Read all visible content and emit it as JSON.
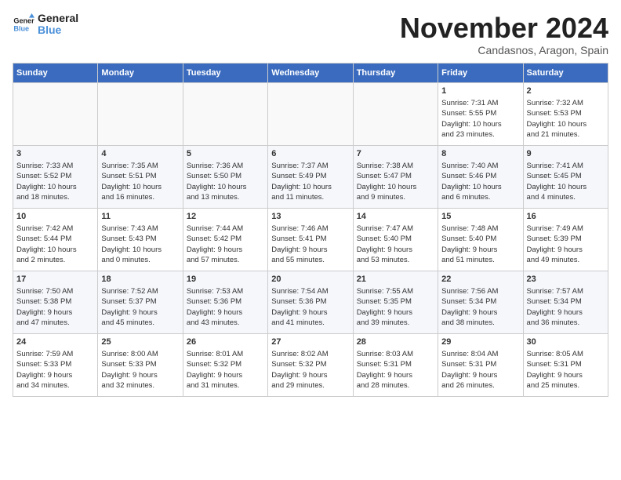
{
  "logo": {
    "line1": "General",
    "line2": "Blue"
  },
  "title": "November 2024",
  "subtitle": "Candasnos, Aragon, Spain",
  "days_of_week": [
    "Sunday",
    "Monday",
    "Tuesday",
    "Wednesday",
    "Thursday",
    "Friday",
    "Saturday"
  ],
  "weeks": [
    [
      {
        "day": "",
        "info": ""
      },
      {
        "day": "",
        "info": ""
      },
      {
        "day": "",
        "info": ""
      },
      {
        "day": "",
        "info": ""
      },
      {
        "day": "",
        "info": ""
      },
      {
        "day": "1",
        "info": "Sunrise: 7:31 AM\nSunset: 5:55 PM\nDaylight: 10 hours\nand 23 minutes."
      },
      {
        "day": "2",
        "info": "Sunrise: 7:32 AM\nSunset: 5:53 PM\nDaylight: 10 hours\nand 21 minutes."
      }
    ],
    [
      {
        "day": "3",
        "info": "Sunrise: 7:33 AM\nSunset: 5:52 PM\nDaylight: 10 hours\nand 18 minutes."
      },
      {
        "day": "4",
        "info": "Sunrise: 7:35 AM\nSunset: 5:51 PM\nDaylight: 10 hours\nand 16 minutes."
      },
      {
        "day": "5",
        "info": "Sunrise: 7:36 AM\nSunset: 5:50 PM\nDaylight: 10 hours\nand 13 minutes."
      },
      {
        "day": "6",
        "info": "Sunrise: 7:37 AM\nSunset: 5:49 PM\nDaylight: 10 hours\nand 11 minutes."
      },
      {
        "day": "7",
        "info": "Sunrise: 7:38 AM\nSunset: 5:47 PM\nDaylight: 10 hours\nand 9 minutes."
      },
      {
        "day": "8",
        "info": "Sunrise: 7:40 AM\nSunset: 5:46 PM\nDaylight: 10 hours\nand 6 minutes."
      },
      {
        "day": "9",
        "info": "Sunrise: 7:41 AM\nSunset: 5:45 PM\nDaylight: 10 hours\nand 4 minutes."
      }
    ],
    [
      {
        "day": "10",
        "info": "Sunrise: 7:42 AM\nSunset: 5:44 PM\nDaylight: 10 hours\nand 2 minutes."
      },
      {
        "day": "11",
        "info": "Sunrise: 7:43 AM\nSunset: 5:43 PM\nDaylight: 10 hours\nand 0 minutes."
      },
      {
        "day": "12",
        "info": "Sunrise: 7:44 AM\nSunset: 5:42 PM\nDaylight: 9 hours\nand 57 minutes."
      },
      {
        "day": "13",
        "info": "Sunrise: 7:46 AM\nSunset: 5:41 PM\nDaylight: 9 hours\nand 55 minutes."
      },
      {
        "day": "14",
        "info": "Sunrise: 7:47 AM\nSunset: 5:40 PM\nDaylight: 9 hours\nand 53 minutes."
      },
      {
        "day": "15",
        "info": "Sunrise: 7:48 AM\nSunset: 5:40 PM\nDaylight: 9 hours\nand 51 minutes."
      },
      {
        "day": "16",
        "info": "Sunrise: 7:49 AM\nSunset: 5:39 PM\nDaylight: 9 hours\nand 49 minutes."
      }
    ],
    [
      {
        "day": "17",
        "info": "Sunrise: 7:50 AM\nSunset: 5:38 PM\nDaylight: 9 hours\nand 47 minutes."
      },
      {
        "day": "18",
        "info": "Sunrise: 7:52 AM\nSunset: 5:37 PM\nDaylight: 9 hours\nand 45 minutes."
      },
      {
        "day": "19",
        "info": "Sunrise: 7:53 AM\nSunset: 5:36 PM\nDaylight: 9 hours\nand 43 minutes."
      },
      {
        "day": "20",
        "info": "Sunrise: 7:54 AM\nSunset: 5:36 PM\nDaylight: 9 hours\nand 41 minutes."
      },
      {
        "day": "21",
        "info": "Sunrise: 7:55 AM\nSunset: 5:35 PM\nDaylight: 9 hours\nand 39 minutes."
      },
      {
        "day": "22",
        "info": "Sunrise: 7:56 AM\nSunset: 5:34 PM\nDaylight: 9 hours\nand 38 minutes."
      },
      {
        "day": "23",
        "info": "Sunrise: 7:57 AM\nSunset: 5:34 PM\nDaylight: 9 hours\nand 36 minutes."
      }
    ],
    [
      {
        "day": "24",
        "info": "Sunrise: 7:59 AM\nSunset: 5:33 PM\nDaylight: 9 hours\nand 34 minutes."
      },
      {
        "day": "25",
        "info": "Sunrise: 8:00 AM\nSunset: 5:33 PM\nDaylight: 9 hours\nand 32 minutes."
      },
      {
        "day": "26",
        "info": "Sunrise: 8:01 AM\nSunset: 5:32 PM\nDaylight: 9 hours\nand 31 minutes."
      },
      {
        "day": "27",
        "info": "Sunrise: 8:02 AM\nSunset: 5:32 PM\nDaylight: 9 hours\nand 29 minutes."
      },
      {
        "day": "28",
        "info": "Sunrise: 8:03 AM\nSunset: 5:31 PM\nDaylight: 9 hours\nand 28 minutes."
      },
      {
        "day": "29",
        "info": "Sunrise: 8:04 AM\nSunset: 5:31 PM\nDaylight: 9 hours\nand 26 minutes."
      },
      {
        "day": "30",
        "info": "Sunrise: 8:05 AM\nSunset: 5:31 PM\nDaylight: 9 hours\nand 25 minutes."
      }
    ]
  ]
}
